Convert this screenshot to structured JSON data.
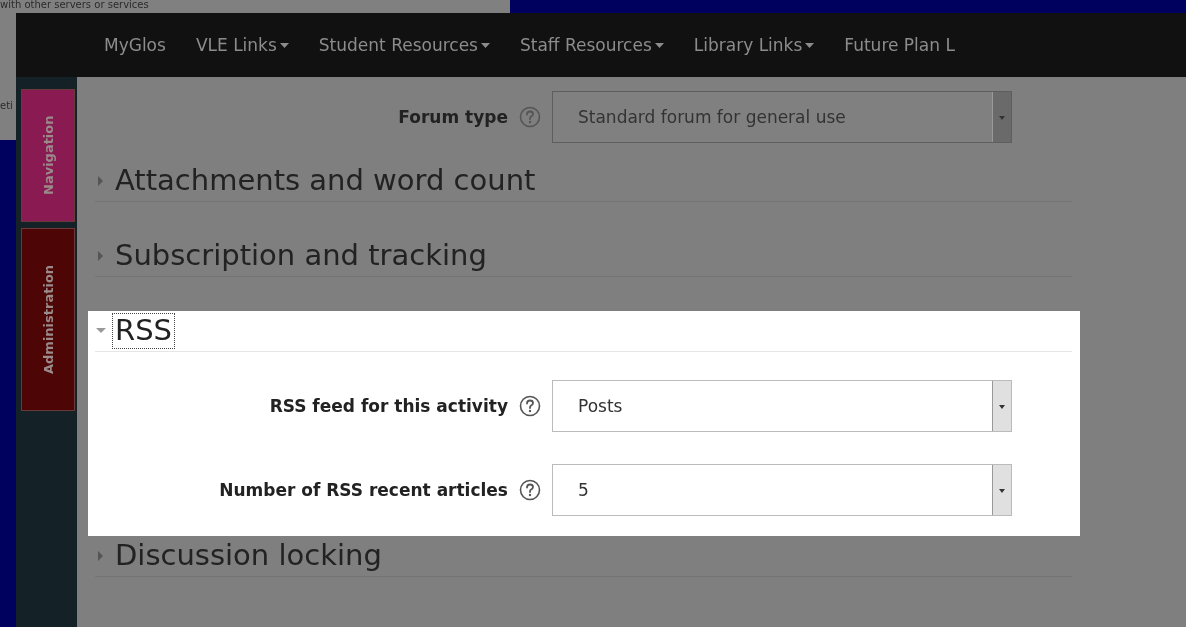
{
  "background_window": {
    "lines": [
      "with other servers or services",
      "eti"
    ]
  },
  "navbar": {
    "items": [
      {
        "label": "MyGlos",
        "dropdown": false
      },
      {
        "label": "VLE Links",
        "dropdown": true
      },
      {
        "label": "Student Resources",
        "dropdown": true
      },
      {
        "label": "Staff Resources",
        "dropdown": true
      },
      {
        "label": "Library Links",
        "dropdown": true
      },
      {
        "label": "Future Plan L",
        "dropdown": false
      }
    ]
  },
  "sidebar": {
    "tabs": [
      {
        "label": "Navigation",
        "color": "#8a1a52"
      },
      {
        "label": "Administration",
        "color": "#4d0505"
      }
    ]
  },
  "top_fields": [
    {
      "label": "Forum type",
      "value": "Standard forum for general use"
    }
  ],
  "sections": [
    {
      "title": "Attachments and word count",
      "expanded": false,
      "highlighted": false,
      "focused": false
    },
    {
      "title": "Subscription and tracking",
      "expanded": false,
      "highlighted": false,
      "focused": false
    },
    {
      "title": "RSS",
      "expanded": true,
      "highlighted": true,
      "focused": true,
      "fields": [
        {
          "label": "RSS feed for this activity",
          "value": "Posts"
        },
        {
          "label": "Number of RSS recent articles",
          "value": "5"
        }
      ]
    },
    {
      "title": "Discussion locking",
      "expanded": false,
      "highlighted": false,
      "focused": false
    }
  ]
}
